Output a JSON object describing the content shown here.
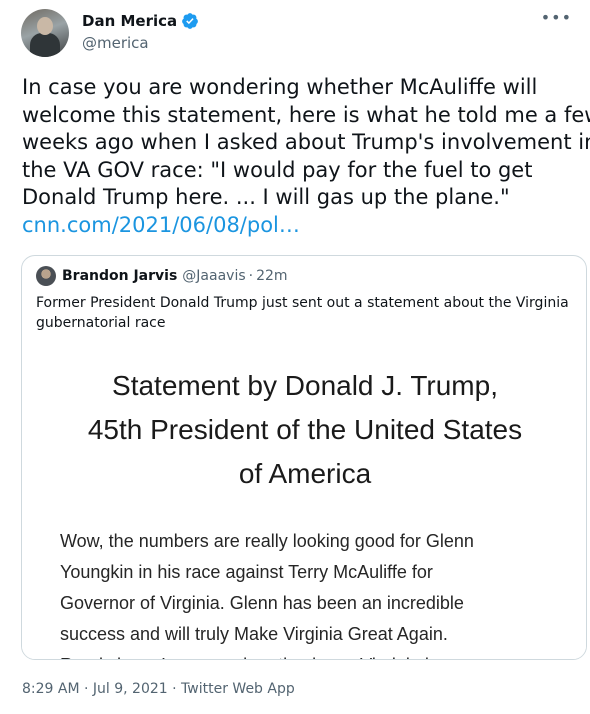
{
  "tweet": {
    "display_name": "Dan Merica",
    "handle": "@merica",
    "more_icon": "more-horizontal-icon",
    "text_lines": [
      "In case you are wondering whether McAuliffe will",
      "welcome this statement, here is what he told me a few",
      "weeks ago when I asked about Trump's involvement in",
      "the VA GOV race: \"I would pay for the fuel to get",
      "Donald Trump here. ... I will gas up the plane.\""
    ],
    "link": "cnn.com/2021/06/08/pol…",
    "footer": {
      "time": "8:29 AM",
      "date": "Jul 9, 2021",
      "app": "Twitter Web App",
      "separator": "·"
    }
  },
  "quote": {
    "name": "Brandon Jarvis",
    "handle": "@Jaaavis",
    "separator": "·",
    "time": "22m",
    "text_lines": [
      "Former President Donald Trump just sent out a statement about the Virginia",
      "gubernatorial race"
    ],
    "image": {
      "title_lines": [
        "Statement by Donald J. Trump,",
        "45th President of the United States",
        "of America"
      ],
      "body_lines": [
        "Wow, the numbers are really looking good for Glenn",
        "Youngkin in his race against Terry McAuliffe for",
        "Governor of Virginia. Glenn has been an incredible",
        "success and will truly Make Virginia Great Again.",
        "Rarely have I seen such enthusiasm. Virginia has so"
      ]
    }
  },
  "colors": {
    "link": "#1b95e0",
    "verified": "#1d9bf0",
    "secondary_text": "#536471",
    "border": "#cfd9de"
  }
}
